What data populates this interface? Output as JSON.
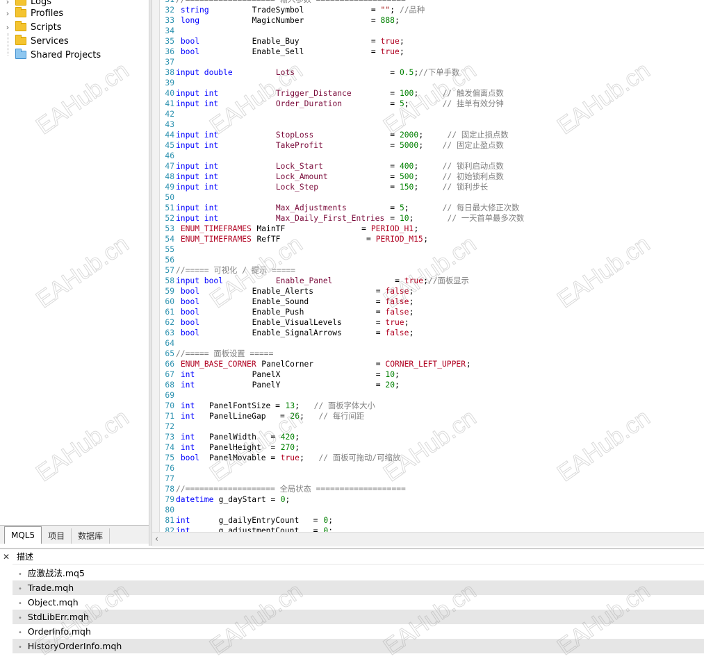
{
  "navigator": {
    "items": [
      {
        "label": "Logs",
        "has_arrow": true,
        "icon": "folder-icon"
      },
      {
        "label": "Profiles",
        "has_arrow": true,
        "icon": "folder-icon"
      },
      {
        "label": "Scripts",
        "has_arrow": true,
        "icon": "folder-icon"
      },
      {
        "label": "Services",
        "has_arrow": false,
        "icon": "folder-icon"
      },
      {
        "label": "Shared Projects",
        "has_arrow": false,
        "icon": "folder-blue-icon"
      }
    ],
    "tabs": [
      "MQL5",
      "项目",
      "数据库"
    ]
  },
  "code_lines": [
    {
      "n": "31",
      "t": [
        {
          "c": "cmt",
          "s": "//=================== 输入参数 ===================",
          "x": 0
        }
      ]
    },
    {
      "n": "32",
      "t": [
        {
          "c": "kw",
          "s": "string",
          "x": 1
        },
        {
          "c": "plain",
          "s": "TradeSymbol",
          "x": 16
        },
        {
          "c": "plain",
          "s": "=",
          "x": 41
        },
        {
          "c": "str",
          "s": "\"\"",
          "x": 43
        },
        {
          "c": "plain",
          "s": ";",
          "x": 45
        },
        {
          "c": "cmt",
          "s": "//品种",
          "x": 47
        }
      ]
    },
    {
      "n": "33",
      "t": [
        {
          "c": "kw",
          "s": "long",
          "x": 1
        },
        {
          "c": "plain",
          "s": "MagicNumber",
          "x": 16
        },
        {
          "c": "plain",
          "s": "=",
          "x": 41
        },
        {
          "c": "num",
          "s": "888",
          "x": 43
        },
        {
          "c": "plain",
          "s": ";",
          "x": 46
        }
      ]
    },
    {
      "n": "34",
      "t": []
    },
    {
      "n": "35",
      "t": [
        {
          "c": "kw",
          "s": "bool",
          "x": 1
        },
        {
          "c": "plain",
          "s": "Enable_Buy",
          "x": 16
        },
        {
          "c": "plain",
          "s": "=",
          "x": 41
        },
        {
          "c": "en",
          "s": "true",
          "x": 43
        },
        {
          "c": "plain",
          "s": ";",
          "x": 47
        }
      ]
    },
    {
      "n": "36",
      "t": [
        {
          "c": "kw",
          "s": "bool",
          "x": 1
        },
        {
          "c": "plain",
          "s": "Enable_Sell",
          "x": 16
        },
        {
          "c": "plain",
          "s": "=",
          "x": 41
        },
        {
          "c": "en",
          "s": "true",
          "x": 43
        },
        {
          "c": "plain",
          "s": ";",
          "x": 47
        }
      ]
    },
    {
      "n": "37",
      "t": []
    },
    {
      "n": "38",
      "t": [
        {
          "c": "kw",
          "s": "input double",
          "x": 0
        },
        {
          "c": "id",
          "s": "Lots",
          "x": 21
        },
        {
          "c": "plain",
          "s": "=",
          "x": 45
        },
        {
          "c": "num",
          "s": "0.5",
          "x": 47
        },
        {
          "c": "plain",
          "s": ";",
          "x": 50
        },
        {
          "c": "cmt",
          "s": "//下单手数",
          "x": 51
        }
      ]
    },
    {
      "n": "39",
      "t": []
    },
    {
      "n": "40",
      "t": [
        {
          "c": "kw",
          "s": "input int",
          "x": 0
        },
        {
          "c": "id",
          "s": "Trigger_Distance",
          "x": 21
        },
        {
          "c": "plain",
          "s": "=",
          "x": 45
        },
        {
          "c": "num",
          "s": "100",
          "x": 47
        },
        {
          "c": "plain",
          "s": ";",
          "x": 50
        },
        {
          "c": "cmt",
          "s": "// 触发偏离点数",
          "x": 56
        }
      ]
    },
    {
      "n": "41",
      "t": [
        {
          "c": "kw",
          "s": "input int",
          "x": 0
        },
        {
          "c": "id",
          "s": "Order_Duration",
          "x": 21
        },
        {
          "c": "plain",
          "s": "=",
          "x": 45
        },
        {
          "c": "num",
          "s": "5",
          "x": 47
        },
        {
          "c": "plain",
          "s": ";",
          "x": 48
        },
        {
          "c": "cmt",
          "s": "// 挂单有效分钟",
          "x": 56
        }
      ]
    },
    {
      "n": "42",
      "t": []
    },
    {
      "n": "43",
      "t": []
    },
    {
      "n": "44",
      "t": [
        {
          "c": "kw",
          "s": "input int",
          "x": 0
        },
        {
          "c": "id",
          "s": "StopLoss",
          "x": 21
        },
        {
          "c": "plain",
          "s": "=",
          "x": 45
        },
        {
          "c": "num",
          "s": "2000",
          "x": 47
        },
        {
          "c": "plain",
          "s": ";",
          "x": 51
        },
        {
          "c": "cmt",
          "s": "// 固定止损点数",
          "x": 57
        }
      ]
    },
    {
      "n": "45",
      "t": [
        {
          "c": "kw",
          "s": "input int",
          "x": 0
        },
        {
          "c": "id",
          "s": "TakeProfit",
          "x": 21
        },
        {
          "c": "plain",
          "s": "=",
          "x": 45
        },
        {
          "c": "num",
          "s": "5000",
          "x": 47
        },
        {
          "c": "plain",
          "s": ";",
          "x": 51
        },
        {
          "c": "cmt",
          "s": "// 固定止盈点数",
          "x": 56
        }
      ]
    },
    {
      "n": "46",
      "t": []
    },
    {
      "n": "47",
      "t": [
        {
          "c": "kw",
          "s": "input int",
          "x": 0
        },
        {
          "c": "id",
          "s": "Lock_Start",
          "x": 21
        },
        {
          "c": "plain",
          "s": "=",
          "x": 45
        },
        {
          "c": "num",
          "s": "400",
          "x": 47
        },
        {
          "c": "plain",
          "s": ";",
          "x": 50
        },
        {
          "c": "cmt",
          "s": "// 锁利启动点数",
          "x": 56
        }
      ]
    },
    {
      "n": "48",
      "t": [
        {
          "c": "kw",
          "s": "input int",
          "x": 0
        },
        {
          "c": "id",
          "s": "Lock_Amount",
          "x": 21
        },
        {
          "c": "plain",
          "s": "=",
          "x": 45
        },
        {
          "c": "num",
          "s": "500",
          "x": 47
        },
        {
          "c": "plain",
          "s": ";",
          "x": 50
        },
        {
          "c": "cmt",
          "s": "// 初始锁利点数",
          "x": 56
        }
      ]
    },
    {
      "n": "49",
      "t": [
        {
          "c": "kw",
          "s": "input int",
          "x": 0
        },
        {
          "c": "id",
          "s": "Lock_Step",
          "x": 21
        },
        {
          "c": "plain",
          "s": "=",
          "x": 45
        },
        {
          "c": "num",
          "s": "150",
          "x": 47
        },
        {
          "c": "plain",
          "s": ";",
          "x": 50
        },
        {
          "c": "cmt",
          "s": "// 锁利步长",
          "x": 56
        }
      ]
    },
    {
      "n": "50",
      "t": []
    },
    {
      "n": "51",
      "t": [
        {
          "c": "kw",
          "s": "input int",
          "x": 0
        },
        {
          "c": "id",
          "s": "Max_Adjustments",
          "x": 21
        },
        {
          "c": "plain",
          "s": "=",
          "x": 45
        },
        {
          "c": "num",
          "s": "5",
          "x": 47
        },
        {
          "c": "plain",
          "s": ";",
          "x": 48
        },
        {
          "c": "cmt",
          "s": "// 每日最大修正次数",
          "x": 56
        }
      ]
    },
    {
      "n": "52",
      "t": [
        {
          "c": "kw",
          "s": "input int",
          "x": 0
        },
        {
          "c": "id",
          "s": "Max_Daily_First_Entries",
          "x": 21
        },
        {
          "c": "plain",
          "s": "=",
          "x": 45
        },
        {
          "c": "num",
          "s": "10",
          "x": 47
        },
        {
          "c": "plain",
          "s": ";",
          "x": 49
        },
        {
          "c": "cmt",
          "s": "// 一天首单最多次数",
          "x": 57
        }
      ]
    },
    {
      "n": "53",
      "t": [
        {
          "c": "en",
          "s": "ENUM_TIMEFRAMES",
          "x": 1
        },
        {
          "c": "plain",
          "s": "MainTF",
          "x": 17
        },
        {
          "c": "plain",
          "s": "=",
          "x": 39
        },
        {
          "c": "en",
          "s": "PERIOD_H1",
          "x": 41
        },
        {
          "c": "plain",
          "s": ";",
          "x": 50
        }
      ]
    },
    {
      "n": "54",
      "t": [
        {
          "c": "en",
          "s": "ENUM_TIMEFRAMES",
          "x": 1
        },
        {
          "c": "plain",
          "s": "RefTF",
          "x": 17
        },
        {
          "c": "plain",
          "s": "=",
          "x": 40
        },
        {
          "c": "en",
          "s": "PERIOD_M15",
          "x": 42
        },
        {
          "c": "plain",
          "s": ";",
          "x": 52
        }
      ]
    },
    {
      "n": "55",
      "t": []
    },
    {
      "n": "56",
      "t": []
    },
    {
      "n": "57",
      "t": [
        {
          "c": "cmt",
          "s": "//===== 可视化 / 提示 =====",
          "x": 0
        }
      ]
    },
    {
      "n": "58",
      "t": [
        {
          "c": "kw",
          "s": "input bool",
          "x": 0
        },
        {
          "c": "id",
          "s": "Enable_Panel",
          "x": 21
        },
        {
          "c": "plain",
          "s": "=",
          "x": 46
        },
        {
          "c": "en",
          "s": "true",
          "x": 48
        },
        {
          "c": "plain",
          "s": ";",
          "x": 52
        },
        {
          "c": "cmt",
          "s": "//面板显示",
          "x": 53
        }
      ]
    },
    {
      "n": "59",
      "t": [
        {
          "c": "kw",
          "s": "bool",
          "x": 1
        },
        {
          "c": "plain",
          "s": "Enable_Alerts",
          "x": 16
        },
        {
          "c": "plain",
          "s": "=",
          "x": 42
        },
        {
          "c": "en",
          "s": "false",
          "x": 44
        },
        {
          "c": "plain",
          "s": ";",
          "x": 49
        }
      ]
    },
    {
      "n": "60",
      "t": [
        {
          "c": "kw",
          "s": "bool",
          "x": 1
        },
        {
          "c": "plain",
          "s": "Enable_Sound",
          "x": 16
        },
        {
          "c": "plain",
          "s": "=",
          "x": 42
        },
        {
          "c": "en",
          "s": "false",
          "x": 44
        },
        {
          "c": "plain",
          "s": ";",
          "x": 49
        }
      ]
    },
    {
      "n": "61",
      "t": [
        {
          "c": "kw",
          "s": "bool",
          "x": 1
        },
        {
          "c": "plain",
          "s": "Enable_Push",
          "x": 16
        },
        {
          "c": "plain",
          "s": "=",
          "x": 42
        },
        {
          "c": "en",
          "s": "false",
          "x": 44
        },
        {
          "c": "plain",
          "s": ";",
          "x": 49
        }
      ]
    },
    {
      "n": "62",
      "t": [
        {
          "c": "kw",
          "s": "bool",
          "x": 1
        },
        {
          "c": "plain",
          "s": "Enable_VisualLevels",
          "x": 16
        },
        {
          "c": "plain",
          "s": "=",
          "x": 42
        },
        {
          "c": "en",
          "s": "true",
          "x": 44
        },
        {
          "c": "plain",
          "s": ";",
          "x": 48
        }
      ]
    },
    {
      "n": "63",
      "t": [
        {
          "c": "kw",
          "s": "bool",
          "x": 1
        },
        {
          "c": "plain",
          "s": "Enable_SignalArrows",
          "x": 16
        },
        {
          "c": "plain",
          "s": "=",
          "x": 42
        },
        {
          "c": "en",
          "s": "false",
          "x": 44
        },
        {
          "c": "plain",
          "s": ";",
          "x": 49
        }
      ]
    },
    {
      "n": "64",
      "t": []
    },
    {
      "n": "65",
      "t": [
        {
          "c": "cmt",
          "s": "//===== 面板设置 =====",
          "x": 0
        }
      ]
    },
    {
      "n": "66",
      "t": [
        {
          "c": "en",
          "s": "ENUM_BASE_CORNER",
          "x": 1
        },
        {
          "c": "plain",
          "s": "PanelCorner",
          "x": 18
        },
        {
          "c": "plain",
          "s": "=",
          "x": 42
        },
        {
          "c": "en",
          "s": "CORNER_LEFT_UPPER",
          "x": 44
        },
        {
          "c": "plain",
          "s": ";",
          "x": 61
        }
      ]
    },
    {
      "n": "67",
      "t": [
        {
          "c": "kw",
          "s": "int",
          "x": 1
        },
        {
          "c": "plain",
          "s": "PanelX",
          "x": 16
        },
        {
          "c": "plain",
          "s": "=",
          "x": 42
        },
        {
          "c": "num",
          "s": "10",
          "x": 44
        },
        {
          "c": "plain",
          "s": ";",
          "x": 46
        }
      ]
    },
    {
      "n": "68",
      "t": [
        {
          "c": "kw",
          "s": "int",
          "x": 1
        },
        {
          "c": "plain",
          "s": "PanelY",
          "x": 16
        },
        {
          "c": "plain",
          "s": "=",
          "x": 42
        },
        {
          "c": "num",
          "s": "20",
          "x": 44
        },
        {
          "c": "plain",
          "s": ";",
          "x": 46
        }
      ]
    },
    {
      "n": "69",
      "t": []
    },
    {
      "n": "70",
      "t": [
        {
          "c": "kw",
          "s": "int",
          "x": 1
        },
        {
          "c": "plain",
          "s": "PanelFontSize = ",
          "x": 7
        },
        {
          "c": "num",
          "s": "13",
          "x": 23
        },
        {
          "c": "plain",
          "s": ";",
          "x": 25
        },
        {
          "c": "cmt",
          "s": "// 面板字体大小",
          "x": 29
        }
      ]
    },
    {
      "n": "71",
      "t": [
        {
          "c": "kw",
          "s": "int",
          "x": 1
        },
        {
          "c": "plain",
          "s": "PanelLineGap   = ",
          "x": 7
        },
        {
          "c": "num",
          "s": "26",
          "x": 24
        },
        {
          "c": "plain",
          "s": ";",
          "x": 26
        },
        {
          "c": "cmt",
          "s": "// 每行间距",
          "x": 30
        }
      ]
    },
    {
      "n": "72",
      "t": []
    },
    {
      "n": "73",
      "t": [
        {
          "c": "kw",
          "s": "int",
          "x": 1
        },
        {
          "c": "plain",
          "s": "PanelWidth   = ",
          "x": 7
        },
        {
          "c": "num",
          "s": "420",
          "x": 22
        },
        {
          "c": "plain",
          "s": ";",
          "x": 25
        }
      ]
    },
    {
      "n": "74",
      "t": [
        {
          "c": "kw",
          "s": "int",
          "x": 1
        },
        {
          "c": "plain",
          "s": "PanelHeight  = ",
          "x": 7
        },
        {
          "c": "num",
          "s": "270",
          "x": 22
        },
        {
          "c": "plain",
          "s": ";",
          "x": 25
        }
      ]
    },
    {
      "n": "75",
      "t": [
        {
          "c": "kw",
          "s": "bool",
          "x": 1
        },
        {
          "c": "plain",
          "s": "PanelMovable = ",
          "x": 7
        },
        {
          "c": "en",
          "s": "true",
          "x": 22
        },
        {
          "c": "plain",
          "s": ";",
          "x": 26
        },
        {
          "c": "cmt",
          "s": "// 面板可拖动/可缩放",
          "x": 30
        }
      ]
    },
    {
      "n": "76",
      "t": []
    },
    {
      "n": "77",
      "t": []
    },
    {
      "n": "78",
      "t": [
        {
          "c": "cmt",
          "s": "//=================== 全局状态 ===================",
          "x": 0
        }
      ]
    },
    {
      "n": "79",
      "t": [
        {
          "c": "kw",
          "s": "datetime",
          "x": 0
        },
        {
          "c": "plain",
          "s": "g_dayStart = ",
          "x": 9
        },
        {
          "c": "num",
          "s": "0",
          "x": 22
        },
        {
          "c": "plain",
          "s": ";",
          "x": 23
        }
      ]
    },
    {
      "n": "80",
      "t": []
    },
    {
      "n": "81",
      "t": [
        {
          "c": "kw",
          "s": "int",
          "x": 0
        },
        {
          "c": "plain",
          "s": "g_dailyEntryCount   = ",
          "x": 9
        },
        {
          "c": "num",
          "s": "0",
          "x": 31
        },
        {
          "c": "plain",
          "s": ";",
          "x": 32
        }
      ]
    },
    {
      "n": "82",
      "t": [
        {
          "c": "kw",
          "s": "int",
          "x": 0
        },
        {
          "c": "plain",
          "s": "g_adjustmentCount   = ",
          "x": 9
        },
        {
          "c": "num",
          "s": "0",
          "x": 31
        },
        {
          "c": "plain",
          "s": ";",
          "x": 32
        }
      ]
    }
  ],
  "bottom_panel": {
    "header": "描述",
    "close_glyph": "✕",
    "files": [
      "应激战法.mq5",
      "Trade.mqh",
      "Object.mqh",
      "StdLibErr.mqh",
      "OrderInfo.mqh",
      "HistoryOrderInfo.mqh"
    ]
  },
  "watermark": "EAHub.cn",
  "colors": {
    "keyword": "#0000ff",
    "enum": "#b00020",
    "number": "#008000",
    "comment": "#808080",
    "line_number": "#2b91af"
  }
}
